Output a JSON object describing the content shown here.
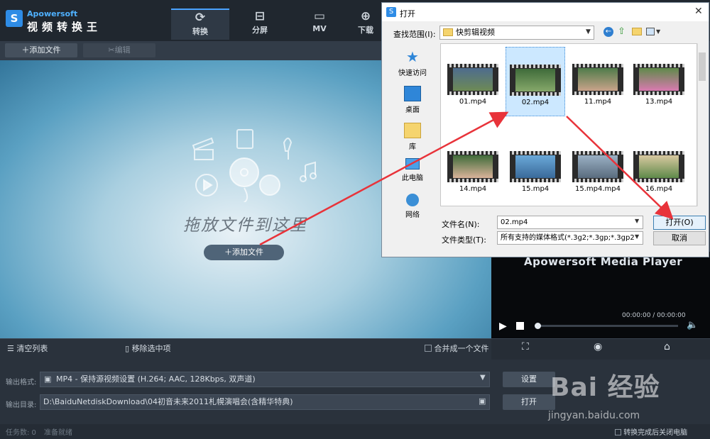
{
  "app": {
    "brand": "Apowersoft",
    "name": "视频转换王"
  },
  "tabs": [
    {
      "label": "转换",
      "icon": "refresh-icon"
    },
    {
      "label": "分屏",
      "icon": "split-screen-icon"
    },
    {
      "label": "MV",
      "icon": "tv-icon"
    },
    {
      "label": "下载",
      "icon": "download-icon"
    }
  ],
  "toolbar": {
    "add_file": "添加文件",
    "edit": "编辑"
  },
  "dropzone": {
    "text": "拖放文件到这里",
    "add_file": "添加文件"
  },
  "controls": {
    "clear_list": "清空列表",
    "remove_selected": "移除选中项",
    "merge": "合并成一个文件"
  },
  "output": {
    "format_label": "输出格式:",
    "format_value": "MP4 - 保持源视频设置 (H.264; AAC, 128Kbps, 双声道)",
    "settings": "设置",
    "dir_label": "输出目录:",
    "dir_value": "D:\\BaiduNetdiskDownload\\04初音未来2011札幌演唱会(含精华特典)",
    "open": "打开"
  },
  "status": {
    "tasks": "任务数: 0",
    "ready": "准备就绪",
    "shutdown": "转换完成后关闭电脑"
  },
  "player": {
    "title": "Apowersoft Media Player",
    "time": "00:00:00 / 00:00:00",
    "progress": 0
  },
  "dialog": {
    "title": "打开",
    "lookin_label": "查找范围(I):",
    "lookin_value": "快剪辑视频",
    "places": [
      "快速访问",
      "桌面",
      "库",
      "此电脑",
      "网络"
    ],
    "files": [
      {
        "name": "01.mp4",
        "selected": false
      },
      {
        "name": "02.mp4",
        "selected": true
      },
      {
        "name": "11.mp4",
        "selected": false
      },
      {
        "name": "13.mp4",
        "selected": false
      },
      {
        "name": "14.mp4",
        "selected": false
      },
      {
        "name": "15.mp4",
        "selected": false
      },
      {
        "name": "15.mp4.mp4",
        "selected": false
      },
      {
        "name": "16.mp4",
        "selected": false
      }
    ],
    "filename_label": "文件名(N):",
    "filename_value": "02.mp4",
    "filetype_label": "文件类型(T):",
    "filetype_value": "所有支持的媒体格式(*.3g2;*.3gp;*.3gp2",
    "open_button": "打开(O)",
    "cancel_button": "取消"
  },
  "watermark": {
    "text": "Bai 经验",
    "url": "jingyan.baidu.com"
  },
  "colors": {
    "accent": "#4aa3ff",
    "annotation_arrow": "#e8333a"
  }
}
